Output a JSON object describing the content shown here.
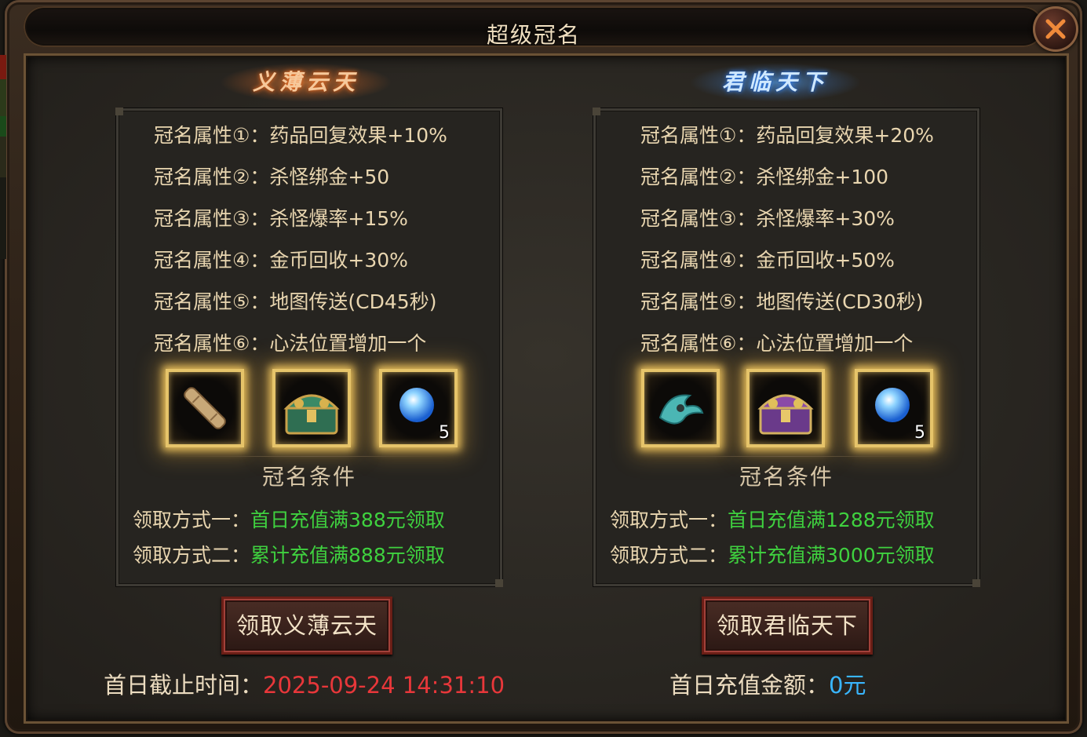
{
  "dialog": {
    "title": "超级冠名"
  },
  "panels": [
    {
      "name": "义薄云天",
      "attributes": [
        {
          "label": "冠名属性①：",
          "value": "药品回复效果+10%"
        },
        {
          "label": "冠名属性②：",
          "value": "杀怪绑金+50"
        },
        {
          "label": "冠名属性③：",
          "value": "杀怪爆率+15%"
        },
        {
          "label": "冠名属性④：",
          "value": "金币回收+30%"
        },
        {
          "label": "冠名属性⑤：",
          "value": "地图传送(CD45秒)"
        },
        {
          "label": "冠名属性⑥：",
          "value": "心法位置增加一个"
        }
      ],
      "items": [
        {
          "icon": "scroll-icon",
          "qty": ""
        },
        {
          "icon": "green-treasure-chest-icon",
          "qty": ""
        },
        {
          "icon": "blue-orb-icon",
          "qty": "5"
        }
      ],
      "condition_title": "冠名条件",
      "conditions": [
        {
          "label": "领取方式一：",
          "value": "首日充值满388元领取"
        },
        {
          "label": "领取方式二：",
          "value": "累计充值满888元领取"
        }
      ],
      "button": "领取义薄云天",
      "footer_label": "首日截止时间：",
      "footer_value": "2025-09-24 14:31:10"
    },
    {
      "name": "君临天下",
      "attributes": [
        {
          "label": "冠名属性①：",
          "value": "药品回复效果+20%"
        },
        {
          "label": "冠名属性②：",
          "value": "杀怪绑金+100"
        },
        {
          "label": "冠名属性③：",
          "value": "杀怪爆率+30%"
        },
        {
          "label": "冠名属性④：",
          "value": "金币回收+50%"
        },
        {
          "label": "冠名属性⑤：",
          "value": "地图传送(CD30秒)"
        },
        {
          "label": "冠名属性⑥：",
          "value": "心法位置增加一个"
        }
      ],
      "items": [
        {
          "icon": "cyan-wing-icon",
          "qty": ""
        },
        {
          "icon": "purple-treasure-chest-icon",
          "qty": ""
        },
        {
          "icon": "blue-orb-icon",
          "qty": "5"
        }
      ],
      "condition_title": "冠名条件",
      "conditions": [
        {
          "label": "领取方式一：",
          "value": "首日充值满1288元领取"
        },
        {
          "label": "领取方式二：",
          "value": "累计充值满3000元领取"
        }
      ],
      "button": "领取君临天下",
      "footer_label": "首日充值金额：",
      "footer_value": "0元"
    }
  ],
  "colors": {
    "attribute_text": "#e9d6b0",
    "condition_value": "#3fd13f",
    "deadline": "#e8373a",
    "amount": "#39b6ff",
    "item_glow": "#e6c46a"
  }
}
